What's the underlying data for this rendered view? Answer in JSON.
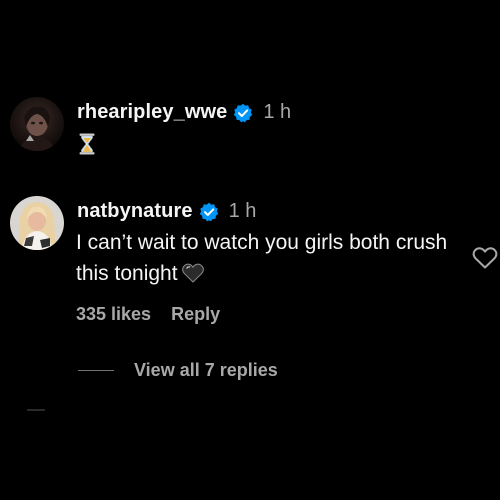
{
  "colors": {
    "background": "#000000",
    "text_primary": "#f5f5f5",
    "text_secondary": "#a8a8a8",
    "verified_badge": "#0095f6",
    "divider": "#737373"
  },
  "comments": [
    {
      "username": "rhearipley_wwe",
      "verified": true,
      "verified_icon": "verified-badge-icon",
      "timestamp": "1 h",
      "body": "⌛",
      "avatar_icon": "avatar-image"
    },
    {
      "username": "natbynature",
      "verified": true,
      "verified_icon": "verified-badge-icon",
      "timestamp": "1 h",
      "body": "I can’t wait to watch you girls both crush this tonight",
      "body_emoji": "black-heart-icon",
      "likes": "335 likes",
      "reply_label": "Reply",
      "like_icon": "heart-outline-icon",
      "avatar_icon": "avatar-image"
    }
  ],
  "replies": {
    "view_all_label": "View all 7 replies"
  }
}
